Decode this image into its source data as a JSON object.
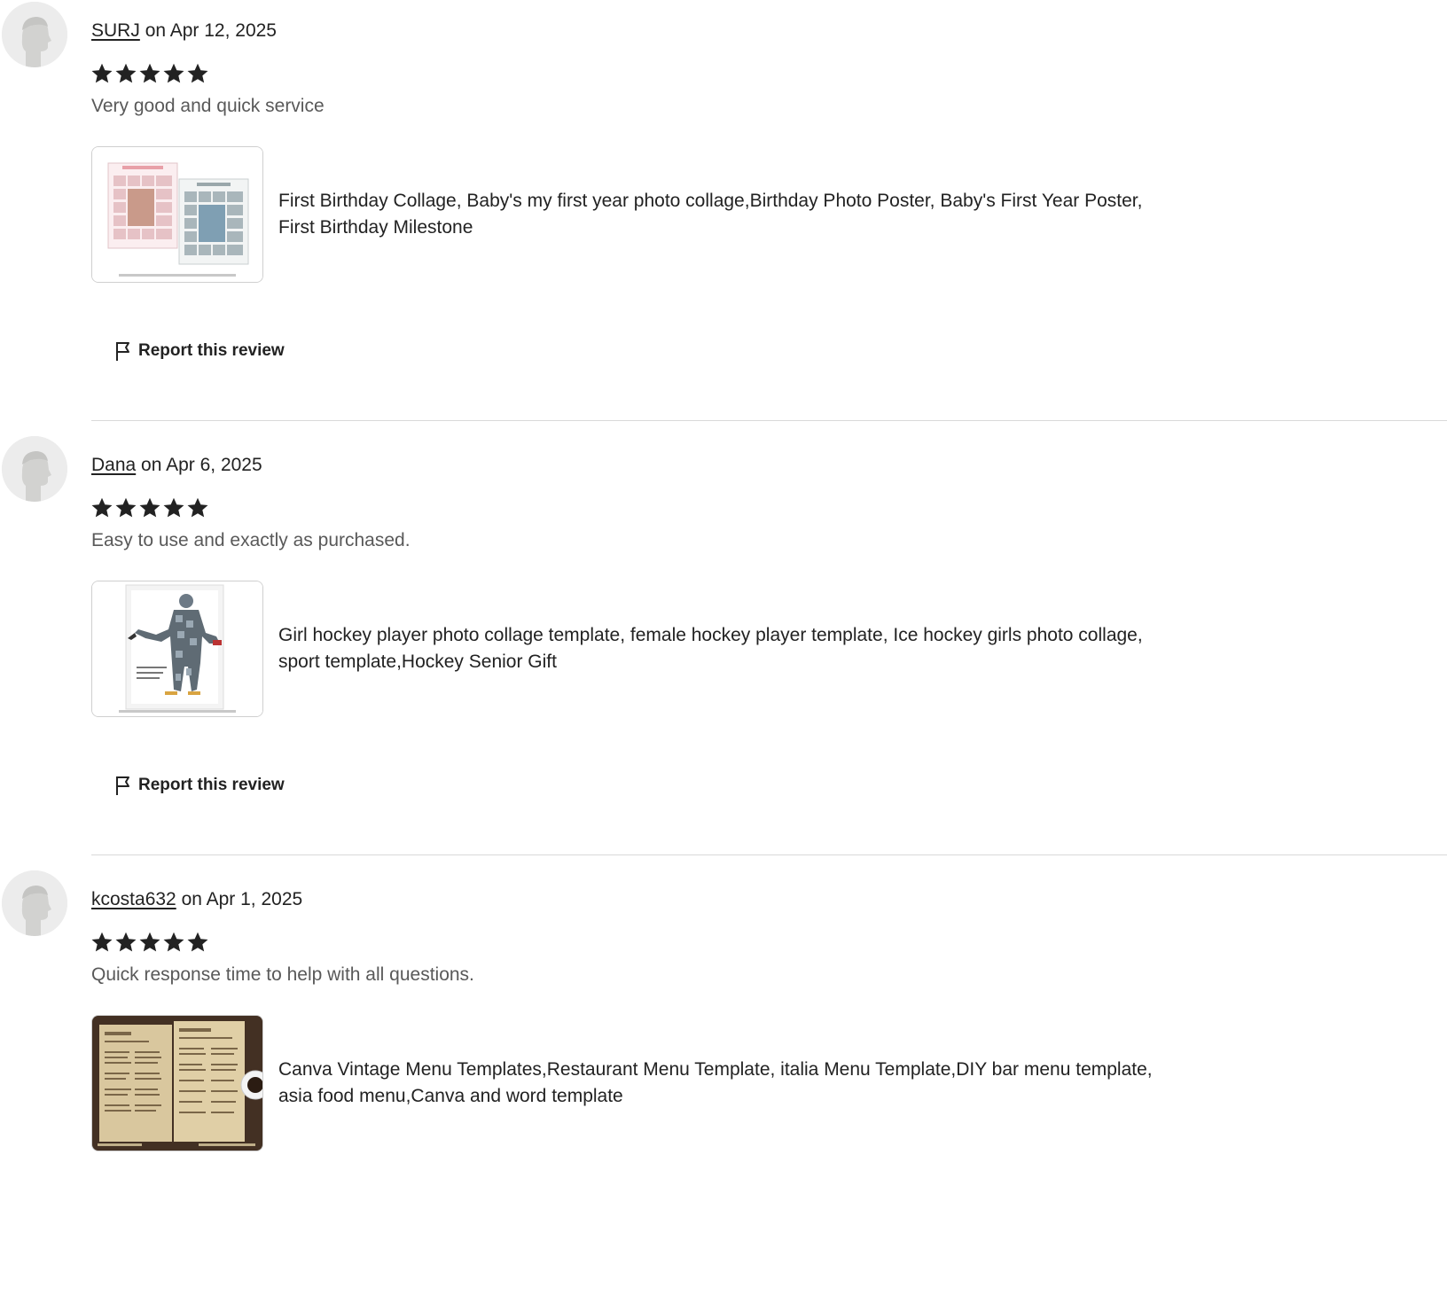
{
  "reviews": [
    {
      "reviewer": "SURJ",
      "date_text": "on Apr 12, 2025",
      "rating": 5,
      "text": "Very good and quick service",
      "product": {
        "title": "First Birthday Collage, Baby's my first year photo collage,Birthday Photo Poster, Baby's First Year Poster, First Birthday Milestone",
        "thumb_icon": "birthday-collage-thumbnail"
      },
      "report_label": "Report this review"
    },
    {
      "reviewer": "Dana",
      "date_text": "on Apr 6, 2025",
      "rating": 5,
      "text": "Easy to use and exactly as purchased.",
      "product": {
        "title": "Girl hockey player photo collage template, female hockey player template, Ice hockey girls photo collage, sport template,Hockey Senior Gift",
        "thumb_icon": "hockey-collage-thumbnail"
      },
      "report_label": "Report this review"
    },
    {
      "reviewer": "kcosta632",
      "date_text": "on Apr 1, 2025",
      "rating": 5,
      "text": "Quick response time to help with all questions.",
      "product": {
        "title": "Canva Vintage Menu Templates,Restaurant Menu Template, italia Menu Template,DIY bar menu template, asia food menu,Canva and word template",
        "thumb_icon": "vintage-menu-thumbnail"
      },
      "report_label": "Report this review"
    }
  ],
  "colors": {
    "text": "#222222",
    "muted_text": "#595959",
    "divider": "#d9d9d9",
    "avatar_bg": "#ececec"
  }
}
